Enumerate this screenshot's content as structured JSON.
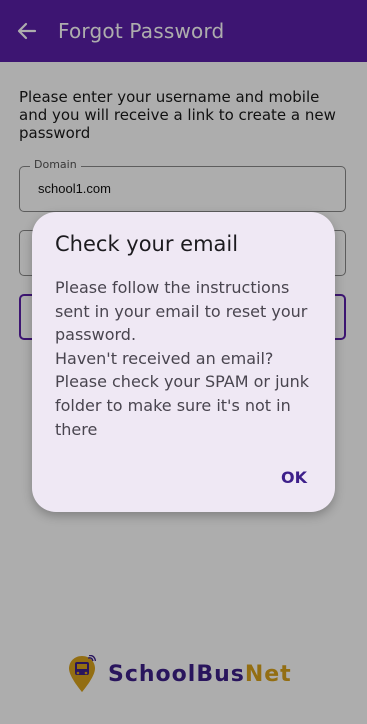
{
  "app_bar": {
    "title": "Forgot Password",
    "back_icon": "arrow-left-icon"
  },
  "form": {
    "intro_text": "Please enter your username and mobile and you will receive a link to create a new password",
    "domain": {
      "label": "Domain",
      "value": "school1.com"
    }
  },
  "dialog": {
    "title": "Check your email",
    "body": "Please follow the instructions sent in your email to reset your password.\nHaven't received an email? Please check your SPAM or junk folder to make sure it's not in there",
    "ok_label": "OK"
  },
  "brand": {
    "name_part1": "SchoolBus",
    "name_part2": "Net",
    "logo_icon": "location-pin-bus-icon"
  },
  "colors": {
    "primary": "#5b20a8",
    "brand_purple": "#3d1f8a",
    "brand_gold": "#d9a21b",
    "dialog_bg": "#efe8f4"
  }
}
